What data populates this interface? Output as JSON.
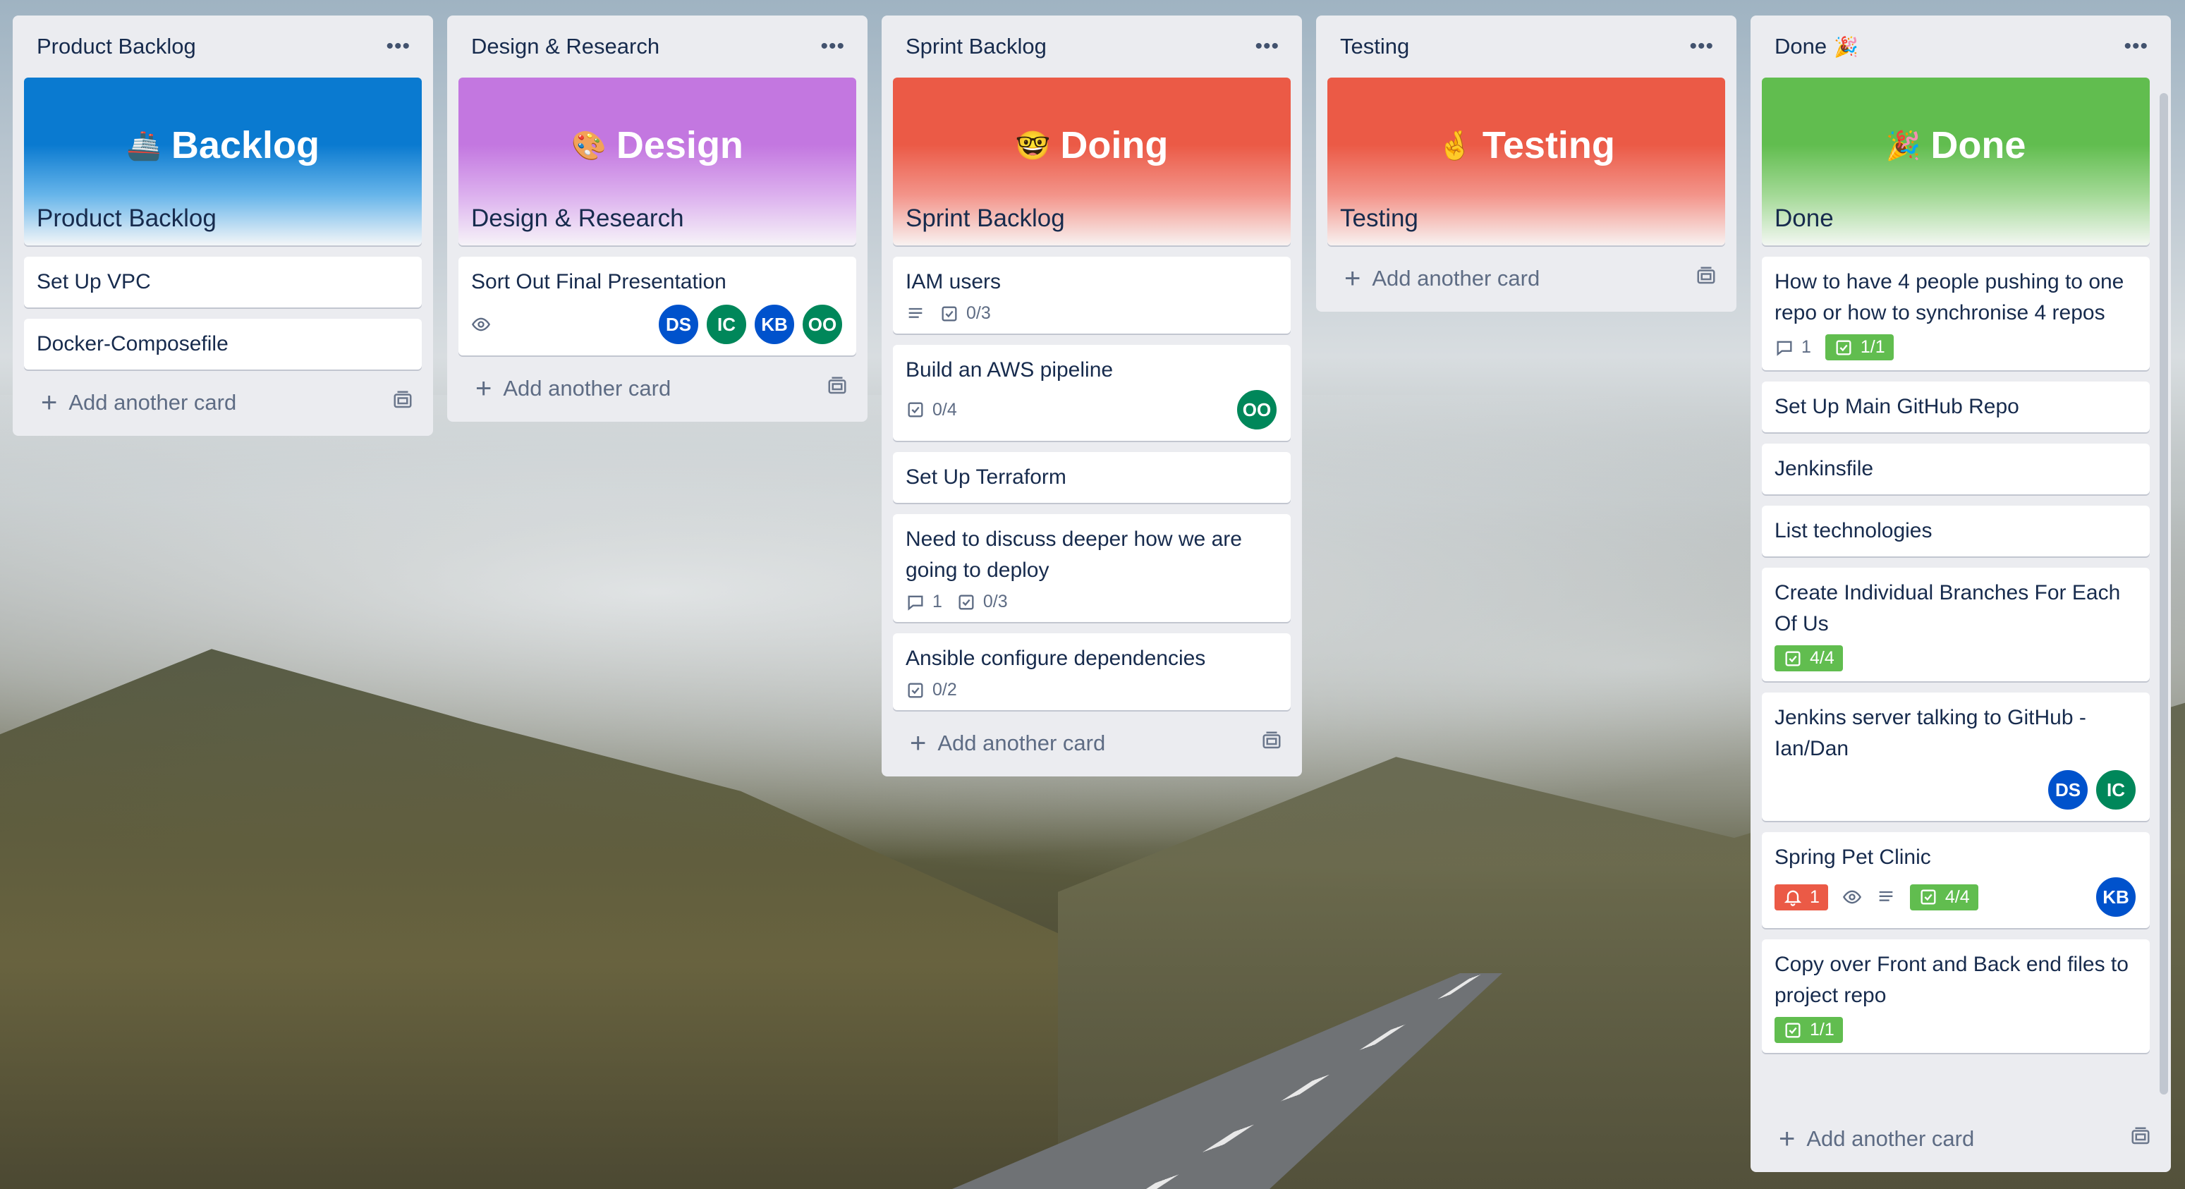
{
  "colors": {
    "list_bg": "#ebecf0",
    "green_badge": "#61bd4f",
    "red_badge": "#eb5a46",
    "avatar_blue": "#0052cc",
    "avatar_green": "#00875a"
  },
  "lists": [
    {
      "title": "Product Backlog",
      "cover": {
        "title": "Backlog",
        "label": "Product Backlog",
        "emoji": "🚢"
      },
      "cards": [
        {
          "title": "Set Up VPC"
        },
        {
          "title": "Docker-Composefile"
        }
      ],
      "add_card": "Add another card"
    },
    {
      "title": "Design & Research",
      "cover": {
        "title": "Design",
        "label": "Design & Research",
        "emoji": "🎨"
      },
      "cards": [
        {
          "title": "Sort Out Final Presentation",
          "members": [
            "DS",
            "IC",
            "KB",
            "OO"
          ]
        }
      ],
      "add_card": "Add another card"
    },
    {
      "title": "Sprint Backlog",
      "cover": {
        "title": "Doing",
        "label": "Sprint Backlog",
        "emoji": "🤓"
      },
      "cards": [
        {
          "title": "IAM users",
          "checklist": "0/3"
        },
        {
          "title": "Build an AWS pipeline",
          "checklist": "0/4",
          "members": [
            "OO"
          ]
        },
        {
          "title": "Set Up Terraform"
        },
        {
          "title": "Need to discuss deeper how we are going to deploy",
          "comments": "1",
          "checklist": "0/3"
        },
        {
          "title": "Ansible configure dependencies",
          "checklist": "0/2"
        }
      ],
      "add_card": "Add another card"
    },
    {
      "title": "Testing",
      "cover": {
        "title": "Testing",
        "label": "Testing",
        "emoji": "🤞"
      },
      "cards": [],
      "add_card": "Add another card"
    },
    {
      "title": "Done",
      "title_emoji": "🎉",
      "cover": {
        "title": "Done",
        "label": "Done",
        "emoji": "🎉"
      },
      "cards": [
        {
          "title": "How to have 4 people pushing to one repo or how to synchronise 4 repos",
          "comments": "1",
          "checklist": "1/1"
        },
        {
          "title": "Set Up Main GitHub Repo"
        },
        {
          "title": "Jenkinsfile"
        },
        {
          "title": "List technologies"
        },
        {
          "title": "Create Individual Branches For Each Of Us",
          "checklist": "4/4"
        },
        {
          "title": "Jenkins server talking to GitHub - Ian/Dan",
          "members": [
            "DS",
            "IC"
          ]
        },
        {
          "title": "Spring Pet Clinic",
          "notifications": "1",
          "checklist": "4/4",
          "members": [
            "KB"
          ]
        },
        {
          "title": "Copy over Front and Back end files to project repo",
          "checklist": "1/1"
        }
      ],
      "add_card": "Add another card"
    }
  ],
  "icons": {
    "menu": "•••",
    "plus": "+"
  }
}
